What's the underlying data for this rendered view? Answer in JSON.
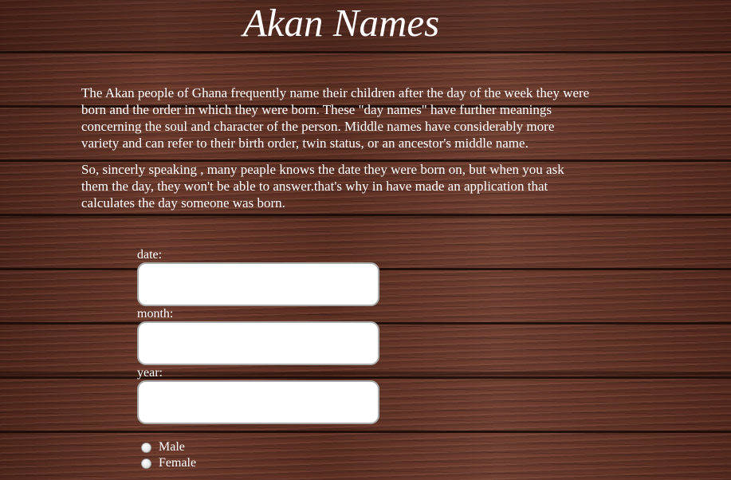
{
  "page": {
    "title": "Akan Names"
  },
  "intro": {
    "paragraph_1": "The Akan people of Ghana frequently name their children after the day of the week they were born and the order in which they were born. These \"day names\" have further meanings concerning the soul and character of the person. Middle names have considerably more variety and can refer to their birth order, twin status, or an ancestor's middle name.",
    "paragraph_2": "So, sincerly speaking , many peaple knows the date they were born on, but when you ask them the day, they won't be able to answer.that's why in have made an application that calculates the day someone was born."
  },
  "form": {
    "date_label": "date:",
    "date_value": "",
    "month_label": "month:",
    "month_value": "",
    "year_label": "year:",
    "year_value": "",
    "gender_options": [
      {
        "label": "Male",
        "checked": false
      },
      {
        "label": "Female",
        "checked": false
      }
    ]
  },
  "colors": {
    "text": "#ffffff",
    "background_wood": "#5a2e22",
    "input_background": "#ffffff",
    "input_border": "#a9a9a9"
  }
}
